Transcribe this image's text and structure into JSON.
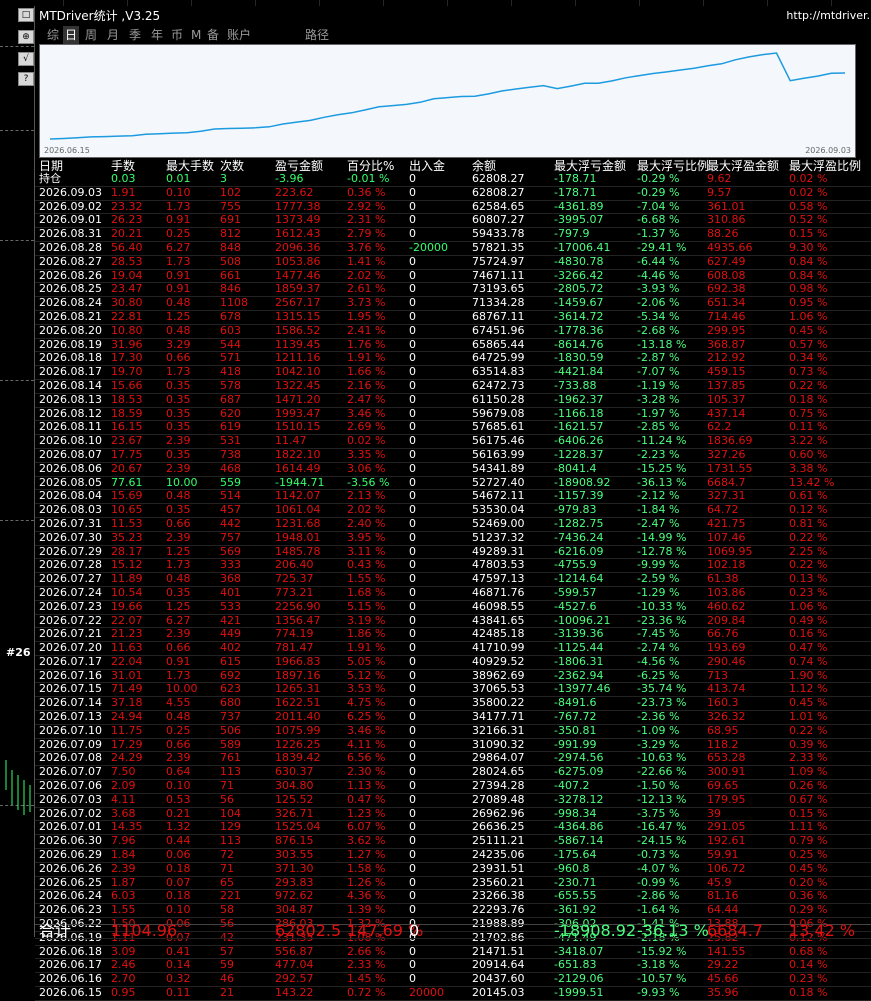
{
  "window": {
    "title": "MTDriver统计 ,V3.25",
    "url": "http://mtdriver."
  },
  "side": {
    "label": "#26"
  },
  "tabs": [
    "综",
    "日",
    "周",
    "月",
    "季",
    "年",
    "币",
    "M",
    "备",
    "账户",
    "路径"
  ],
  "active_tab": "日",
  "chart": {
    "start_label": "2026.06.15",
    "end_label": "2026.09.03",
    "line_color": "#1c9be0"
  },
  "columns": [
    "日期",
    "手数",
    "最大手数",
    "次数",
    "盈亏金额",
    "百分比%",
    "出入金",
    "余额",
    "最大浮亏金额",
    "最大浮亏比例",
    "最大浮盈金额",
    "最大浮盈比例"
  ],
  "rows": [
    [
      "持仓",
      "0.03",
      "0.01",
      "3",
      "-3.96",
      "-0.01 %",
      "0",
      "62808.27",
      "-178.71",
      "-0.29 %",
      "9.62",
      "0.02 %"
    ],
    [
      "2026.09.03",
      "1.91",
      "0.10",
      "102",
      "223.62",
      "0.36 %",
      "0",
      "62808.27",
      "-178.71",
      "-0.29 %",
      "9.57",
      "0.02 %"
    ],
    [
      "2026.09.02",
      "23.32",
      "1.73",
      "755",
      "1777.38",
      "2.92 %",
      "0",
      "62584.65",
      "-4361.89",
      "-7.04 %",
      "361.01",
      "0.58 %"
    ],
    [
      "2026.09.01",
      "26.23",
      "0.91",
      "691",
      "1373.49",
      "2.31 %",
      "0",
      "60807.27",
      "-3995.07",
      "-6.68 %",
      "310.86",
      "0.52 %"
    ],
    [
      "2026.08.31",
      "20.21",
      "0.25",
      "812",
      "1612.43",
      "2.79 %",
      "0",
      "59433.78",
      "-797.9",
      "-1.37 %",
      "88.26",
      "0.15 %"
    ],
    [
      "2026.08.28",
      "56.40",
      "6.27",
      "848",
      "2096.36",
      "3.76 %",
      "-20000",
      "57821.35",
      "-17006.41",
      "-29.41 %",
      "4935.66",
      "9.30 %"
    ],
    [
      "2026.08.27",
      "28.53",
      "1.73",
      "508",
      "1053.86",
      "1.41 %",
      "0",
      "75724.97",
      "-4830.78",
      "-6.44 %",
      "627.49",
      "0.84 %"
    ],
    [
      "2026.08.26",
      "19.04",
      "0.91",
      "661",
      "1477.46",
      "2.02 %",
      "0",
      "74671.11",
      "-3266.42",
      "-4.46 %",
      "608.08",
      "0.84 %"
    ],
    [
      "2026.08.25",
      "23.47",
      "0.91",
      "846",
      "1859.37",
      "2.61 %",
      "0",
      "73193.65",
      "-2805.72",
      "-3.93 %",
      "692.38",
      "0.98 %"
    ],
    [
      "2026.08.24",
      "30.80",
      "0.48",
      "1108",
      "2567.17",
      "3.73 %",
      "0",
      "71334.28",
      "-1459.67",
      "-2.06 %",
      "651.34",
      "0.95 %"
    ],
    [
      "2026.08.21",
      "22.81",
      "1.25",
      "678",
      "1315.15",
      "1.95 %",
      "0",
      "68767.11",
      "-3614.72",
      "-5.34 %",
      "714.46",
      "1.06 %"
    ],
    [
      "2026.08.20",
      "10.80",
      "0.48",
      "603",
      "1586.52",
      "2.41 %",
      "0",
      "67451.96",
      "-1778.36",
      "-2.68 %",
      "299.95",
      "0.45 %"
    ],
    [
      "2026.08.19",
      "31.96",
      "3.29",
      "544",
      "1139.45",
      "1.76 %",
      "0",
      "65865.44",
      "-8614.76",
      "-13.18 %",
      "368.87",
      "0.57 %"
    ],
    [
      "2026.08.18",
      "17.30",
      "0.66",
      "571",
      "1211.16",
      "1.91 %",
      "0",
      "64725.99",
      "-1830.59",
      "-2.87 %",
      "212.92",
      "0.34 %"
    ],
    [
      "2026.08.17",
      "19.70",
      "1.73",
      "418",
      "1042.10",
      "1.66 %",
      "0",
      "63514.83",
      "-4421.84",
      "-7.07 %",
      "459.15",
      "0.73 %"
    ],
    [
      "2026.08.14",
      "15.66",
      "0.35",
      "578",
      "1322.45",
      "2.16 %",
      "0",
      "62472.73",
      "-733.88",
      "-1.19 %",
      "137.85",
      "0.22 %"
    ],
    [
      "2026.08.13",
      "18.53",
      "0.35",
      "687",
      "1471.20",
      "2.47 %",
      "0",
      "61150.28",
      "-1962.37",
      "-3.28 %",
      "105.37",
      "0.18 %"
    ],
    [
      "2026.08.12",
      "18.59",
      "0.35",
      "620",
      "1993.47",
      "3.46 %",
      "0",
      "59679.08",
      "-1166.18",
      "-1.97 %",
      "437.14",
      "0.75 %"
    ],
    [
      "2026.08.11",
      "16.15",
      "0.35",
      "619",
      "1510.15",
      "2.69 %",
      "0",
      "57685.61",
      "-1621.57",
      "-2.85 %",
      "62.2",
      "0.11 %"
    ],
    [
      "2026.08.10",
      "23.67",
      "2.39",
      "531",
      "11.47",
      "0.02 %",
      "0",
      "56175.46",
      "-6406.26",
      "-11.24 %",
      "1836.69",
      "3.22 %"
    ],
    [
      "2026.08.07",
      "17.75",
      "0.35",
      "738",
      "1822.10",
      "3.35 %",
      "0",
      "56163.99",
      "-1228.37",
      "-2.23 %",
      "327.26",
      "0.60 %"
    ],
    [
      "2026.08.06",
      "20.67",
      "2.39",
      "468",
      "1614.49",
      "3.06 %",
      "0",
      "54341.89",
      "-8041.4",
      "-15.25 %",
      "1731.55",
      "3.38 %"
    ],
    [
      "2026.08.05",
      "77.61",
      "10.00",
      "559",
      "-1944.71",
      "-3.56 %",
      "0",
      "52727.40",
      "-18908.92",
      "-36.13 %",
      "6684.7",
      "13.42 %"
    ],
    [
      "2026.08.04",
      "15.69",
      "0.48",
      "514",
      "1142.07",
      "2.13 %",
      "0",
      "54672.11",
      "-1157.39",
      "-2.12 %",
      "327.31",
      "0.61 %"
    ],
    [
      "2026.08.03",
      "10.65",
      "0.35",
      "457",
      "1061.04",
      "2.02 %",
      "0",
      "53530.04",
      "-979.83",
      "-1.84 %",
      "64.72",
      "0.12 %"
    ],
    [
      "2026.07.31",
      "11.53",
      "0.66",
      "442",
      "1231.68",
      "2.40 %",
      "0",
      "52469.00",
      "-1282.75",
      "-2.47 %",
      "421.75",
      "0.81 %"
    ],
    [
      "2026.07.30",
      "35.23",
      "2.39",
      "757",
      "1948.01",
      "3.95 %",
      "0",
      "51237.32",
      "-7436.24",
      "-14.99 %",
      "107.46",
      "0.22 %"
    ],
    [
      "2026.07.29",
      "28.17",
      "1.25",
      "569",
      "1485.78",
      "3.11 %",
      "0",
      "49289.31",
      "-6216.09",
      "-12.78 %",
      "1069.95",
      "2.25 %"
    ],
    [
      "2026.07.28",
      "15.12",
      "1.73",
      "333",
      "206.40",
      "0.43 %",
      "0",
      "47803.53",
      "-4755.9",
      "-9.99 %",
      "102.18",
      "0.22 %"
    ],
    [
      "2026.07.27",
      "11.89",
      "0.48",
      "368",
      "725.37",
      "1.55 %",
      "0",
      "47597.13",
      "-1214.64",
      "-2.59 %",
      "61.38",
      "0.13 %"
    ],
    [
      "2026.07.24",
      "10.54",
      "0.35",
      "401",
      "773.21",
      "1.68 %",
      "0",
      "46871.76",
      "-599.57",
      "-1.29 %",
      "103.86",
      "0.23 %"
    ],
    [
      "2026.07.23",
      "19.66",
      "1.25",
      "533",
      "2256.90",
      "5.15 %",
      "0",
      "46098.55",
      "-4527.6",
      "-10.33 %",
      "460.62",
      "1.06 %"
    ],
    [
      "2026.07.22",
      "22.07",
      "6.27",
      "421",
      "1356.47",
      "3.19 %",
      "0",
      "43841.65",
      "-10096.21",
      "-23.36 %",
      "209.84",
      "0.49 %"
    ],
    [
      "2026.07.21",
      "21.23",
      "2.39",
      "449",
      "774.19",
      "1.86 %",
      "0",
      "42485.18",
      "-3139.36",
      "-7.45 %",
      "66.76",
      "0.16 %"
    ],
    [
      "2026.07.20",
      "11.63",
      "0.66",
      "402",
      "781.47",
      "1.91 %",
      "0",
      "41710.99",
      "-1125.44",
      "-2.74 %",
      "193.69",
      "0.47 %"
    ],
    [
      "2026.07.17",
      "22.04",
      "0.91",
      "615",
      "1966.83",
      "5.05 %",
      "0",
      "40929.52",
      "-1806.31",
      "-4.56 %",
      "290.46",
      "0.74 %"
    ],
    [
      "2026.07.16",
      "31.01",
      "1.73",
      "692",
      "1897.16",
      "5.12 %",
      "0",
      "38962.69",
      "-2362.94",
      "-6.25 %",
      "713",
      "1.90 %"
    ],
    [
      "2026.07.15",
      "71.49",
      "10.00",
      "623",
      "1265.31",
      "3.53 %",
      "0",
      "37065.53",
      "-13977.46",
      "-35.74 %",
      "413.74",
      "1.12 %"
    ],
    [
      "2026.07.14",
      "37.18",
      "4.55",
      "680",
      "1622.51",
      "4.75 %",
      "0",
      "35800.22",
      "-8491.6",
      "-23.73 %",
      "160.3",
      "0.45 %"
    ],
    [
      "2026.07.13",
      "24.94",
      "0.48",
      "737",
      "2011.40",
      "6.25 %",
      "0",
      "34177.71",
      "-767.72",
      "-2.36 %",
      "326.32",
      "1.01 %"
    ],
    [
      "2026.07.10",
      "11.75",
      "0.25",
      "506",
      "1075.99",
      "3.46 %",
      "0",
      "32166.31",
      "-350.81",
      "-1.09 %",
      "68.95",
      "0.22 %"
    ],
    [
      "2026.07.09",
      "17.29",
      "0.66",
      "589",
      "1226.25",
      "4.11 %",
      "0",
      "31090.32",
      "-991.99",
      "-3.29 %",
      "118.2",
      "0.39 %"
    ],
    [
      "2026.07.08",
      "24.29",
      "2.39",
      "761",
      "1839.42",
      "6.56 %",
      "0",
      "29864.07",
      "-2974.56",
      "-10.63 %",
      "653.28",
      "2.33 %"
    ],
    [
      "2026.07.07",
      "7.50",
      "0.64",
      "113",
      "630.37",
      "2.30 %",
      "0",
      "28024.65",
      "-6275.09",
      "-22.66 %",
      "300.91",
      "1.09 %"
    ],
    [
      "2026.07.06",
      "2.09",
      "0.10",
      "71",
      "304.80",
      "1.13 %",
      "0",
      "27394.28",
      "-407.2",
      "-1.50 %",
      "69.65",
      "0.26 %"
    ],
    [
      "2026.07.03",
      "4.11",
      "0.53",
      "56",
      "125.52",
      "0.47 %",
      "0",
      "27089.48",
      "-3278.12",
      "-12.13 %",
      "179.95",
      "0.67 %"
    ],
    [
      "2026.07.02",
      "3.68",
      "0.21",
      "104",
      "326.71",
      "1.23 %",
      "0",
      "26962.96",
      "-998.34",
      "-3.75 %",
      "39",
      "0.15 %"
    ],
    [
      "2026.07.01",
      "14.35",
      "1.32",
      "129",
      "1525.04",
      "6.07 %",
      "0",
      "26636.25",
      "-4364.86",
      "-16.47 %",
      "291.05",
      "1.11 %"
    ],
    [
      "2026.06.30",
      "7.96",
      "0.44",
      "113",
      "876.15",
      "3.62 %",
      "0",
      "25111.21",
      "-5867.14",
      "-24.15 %",
      "192.61",
      "0.79 %"
    ],
    [
      "2026.06.29",
      "1.84",
      "0.06",
      "72",
      "303.55",
      "1.27 %",
      "0",
      "24235.06",
      "-175.64",
      "-0.73 %",
      "59.91",
      "0.25 %"
    ],
    [
      "2026.06.26",
      "2.39",
      "0.18",
      "71",
      "371.30",
      "1.58 %",
      "0",
      "23931.51",
      "-960.8",
      "-4.07 %",
      "106.72",
      "0.45 %"
    ],
    [
      "2026.06.25",
      "1.87",
      "0.07",
      "65",
      "293.83",
      "1.26 %",
      "0",
      "23560.21",
      "-230.71",
      "-0.99 %",
      "45.9",
      "0.20 %"
    ],
    [
      "2026.06.24",
      "6.03",
      "0.18",
      "221",
      "972.62",
      "4.36 %",
      "0",
      "23266.38",
      "-655.55",
      "-2.86 %",
      "81.16",
      "0.36 %"
    ],
    [
      "2026.06.23",
      "1.55",
      "0.10",
      "58",
      "304.87",
      "1.39 %",
      "0",
      "22293.76",
      "-361.92",
      "-1.64 %",
      "64.44",
      "0.29 %"
    ],
    [
      "2026.06.22",
      "1.50",
      "0.06",
      "56",
      "286.03",
      "1.32 %",
      "0",
      "21988.89",
      "-306.02",
      "-1.41 %",
      "13.88",
      "0.06 %"
    ],
    [
      "2026.06.19",
      "1.11",
      "0.07",
      "42",
      "231.35",
      "1.08 %",
      "0",
      "21702.86",
      "-471.49",
      "-2.18 %",
      "25.82",
      "0.12 %"
    ],
    [
      "2026.06.18",
      "3.09",
      "0.41",
      "57",
      "556.87",
      "2.66 %",
      "0",
      "21471.51",
      "-3418.07",
      "-15.92 %",
      "141.55",
      "0.68 %"
    ],
    [
      "2026.06.17",
      "2.46",
      "0.14",
      "59",
      "477.04",
      "2.33 %",
      "0",
      "20914.64",
      "-651.83",
      "-3.18 %",
      "29.22",
      "0.14 %"
    ],
    [
      "2026.06.16",
      "2.70",
      "0.32",
      "46",
      "292.57",
      "1.45 %",
      "0",
      "20437.60",
      "-2129.06",
      "-10.57 %",
      "45.66",
      "0.23 %"
    ],
    [
      "2026.06.15",
      "0.95",
      "0.11",
      "21",
      "143.22",
      "0.72 %",
      "20000",
      "20145.03",
      "-1999.51",
      "-9.93 %",
      "35.96",
      "0.18 %"
    ]
  ],
  "footer": [
    "合计",
    "1104.96",
    "",
    "",
    "62802.5",
    "147.69 %",
    "0",
    "",
    "-18908.92",
    "-36.13 %",
    "6684.7",
    "13.42 %"
  ],
  "colors": {
    "loss": "#e01010",
    "profit": "#35ff6a",
    "neutral": "#ffffff"
  }
}
